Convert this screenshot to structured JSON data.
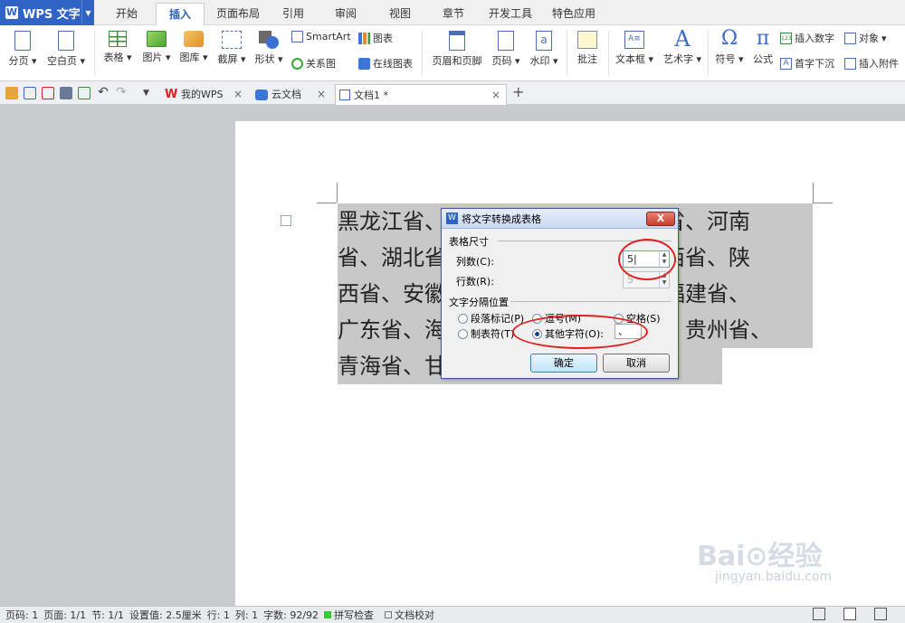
{
  "app": {
    "name": "WPS 文字"
  },
  "menu_tabs": [
    "开始",
    "插入",
    "页面布局",
    "引用",
    "审阅",
    "视图",
    "章节",
    "开发工具",
    "特色应用"
  ],
  "active_menu_tab": "插入",
  "ribbon": {
    "page_break": "分页",
    "blank_page": "空白页",
    "table": "表格",
    "picture": "图片",
    "gallery": "图库",
    "screenshot": "截屏",
    "shape": "形状",
    "smartart": "SmartArt",
    "chart": "图表",
    "relation_chart": "关系图",
    "online_chart": "在线图表",
    "header_footer": "页眉和页脚",
    "page_number": "页码",
    "watermark": "水印",
    "comment": "批注",
    "textbox": "文本框",
    "wordart": "艺术字",
    "symbol": "符号",
    "formula": "公式",
    "insert_number": "插入数字",
    "object": "对象",
    "dropcap": "首字下沉",
    "attachment": "插入附件"
  },
  "doc_tabs": [
    {
      "label": "我的WPS"
    },
    {
      "label": "云文档"
    },
    {
      "label": "文档1 *"
    }
  ],
  "document": {
    "lines": [
      "黑龙江省、吉林省、辽宁省、河北省、河南",
      "省、湖北省、湖南省、山东省、山西省、陕",
      "西省、安徽省、浙江省、江苏省、福建省、",
      "广东省、海南省、四川省、云南省、贵州省、",
      "青海省、甘肃省、江西省、台湾省"
    ]
  },
  "dialog": {
    "title": "将文字转换成表格",
    "close": "X",
    "size_group": "表格尺寸",
    "cols_label": "列数(C):",
    "cols_value": "5",
    "rows_label": "行数(R):",
    "rows_value": "5",
    "sep_group": "文字分隔位置",
    "opt_paragraph": "段落标记(P)",
    "opt_comma": "逗号(M)",
    "opt_space": "空格(S)",
    "opt_tab": "制表符(T)",
    "opt_other": "其他字符(O):",
    "other_value": "、",
    "selected_option": "其他字符",
    "ok": "确定",
    "cancel": "取消"
  },
  "status_bar": {
    "page_num": "页码: 1",
    "pages": "页面: 1/1",
    "section": "节: 1/1",
    "setting": "设置值: 2.5厘米",
    "row": "行: 1",
    "col": "列: 1",
    "words": "字数: 92/92",
    "spell": "拼写检查",
    "proof": "文档校对"
  },
  "watermark": {
    "text": "Bai⊙经验",
    "url": "jingyan.baidu.com"
  },
  "colors": {
    "accent": "#2f63c4",
    "annotation": "#e02020"
  }
}
